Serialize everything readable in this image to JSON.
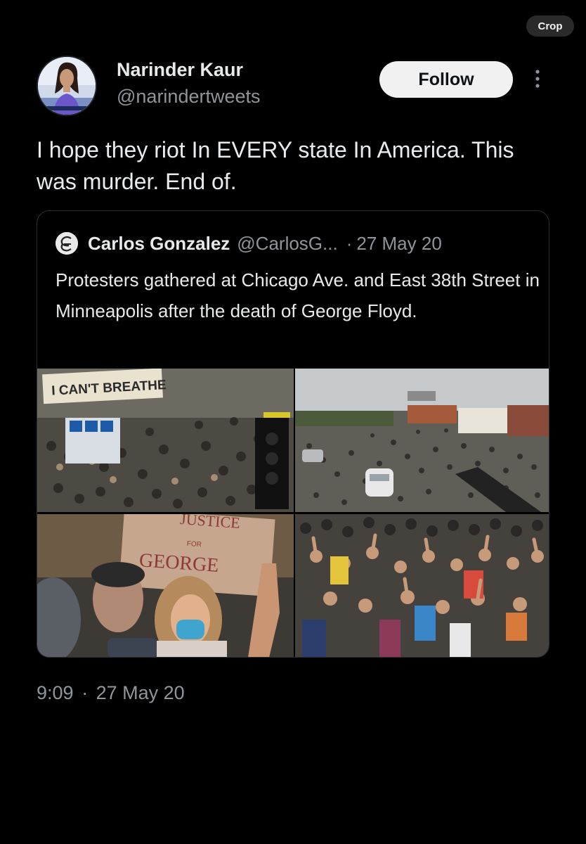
{
  "toolbar": {
    "crop_label": "Crop"
  },
  "tweet": {
    "display_name": "Narinder Kaur",
    "handle": "@narindertweets",
    "follow_label": "Follow",
    "text": "I hope they riot In EVERY state In America. This was murder. End of.",
    "time": "9:09",
    "separator": "·",
    "date": "27 May 20"
  },
  "quote": {
    "display_name": "Carlos Gonzalez",
    "handle": "@CarlosG...",
    "separator": "·",
    "date": "27 May 20",
    "text": "Protesters gathered at Chicago Ave. and East 38th Street in Minneapolis after the death of George Floyd.",
    "photos": [
      {
        "sign_text": "I CAN'T BREATHE"
      },
      {
        "sign_text": ""
      },
      {
        "sign_text_line1": "JUSTICE",
        "sign_text_line2": "FOR",
        "sign_text_line3": "GEORGE"
      },
      {
        "sign_text": ""
      }
    ]
  },
  "icons": {
    "more": "vertical-ellipsis-icon",
    "verified_logo": "quote-avatar-logo"
  }
}
